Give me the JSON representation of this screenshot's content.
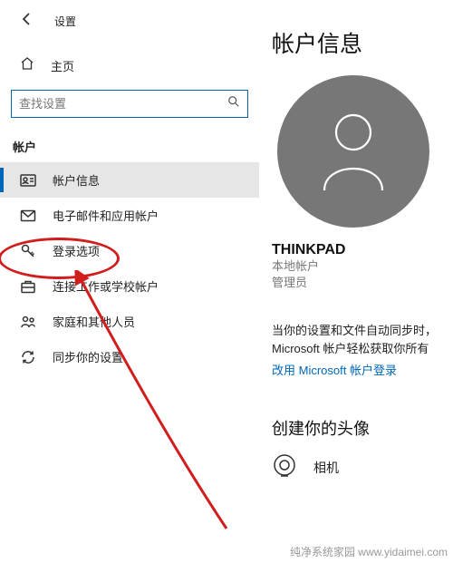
{
  "app_title": "设置",
  "home_label": "主页",
  "search": {
    "placeholder": "查找设置"
  },
  "section_header": "帐户",
  "nav": [
    {
      "label": "帐户信息"
    },
    {
      "label": "电子邮件和应用帐户"
    },
    {
      "label": "登录选项"
    },
    {
      "label": "连接工作或学校帐户"
    },
    {
      "label": "家庭和其他人员"
    },
    {
      "label": "同步你的设置"
    }
  ],
  "page_title": "帐户信息",
  "username": "THINKPAD",
  "account_type": "本地帐户",
  "account_role": "管理员",
  "sync_text_1": "当你的设置和文件自动同步时，",
  "sync_text_2": "Microsoft 帐户轻松获取你所有",
  "switch_link": "改用 Microsoft 帐户登录",
  "avatar_heading": "创建你的头像",
  "camera_label": "相机",
  "watermark": "纯净系统家园   www.yidaimei.com"
}
